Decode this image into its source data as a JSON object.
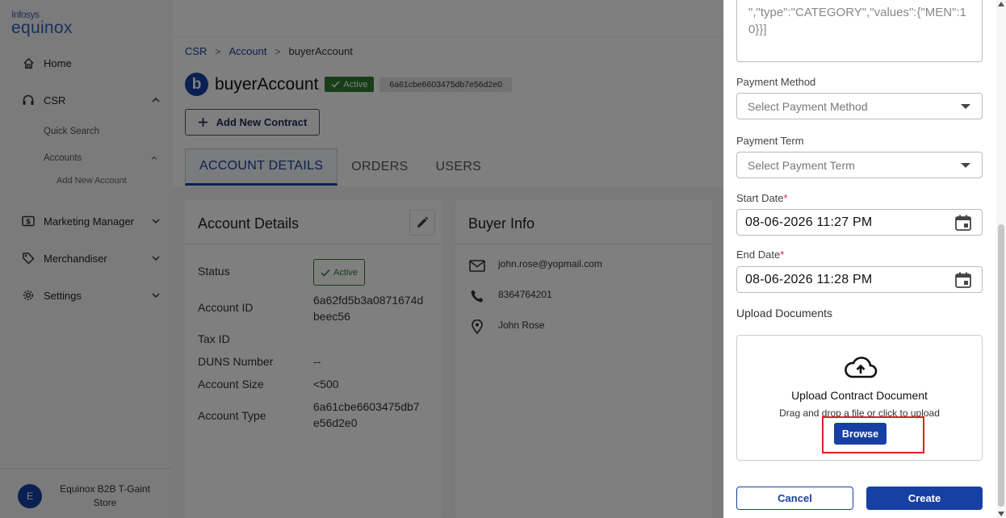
{
  "brand": {
    "line1": "Infosys",
    "line2": "equinox"
  },
  "sidebar": {
    "items": [
      {
        "label": "Home",
        "icon": "home-icon"
      },
      {
        "label": "CSR",
        "icon": "headset-icon"
      },
      {
        "label": "Marketing Manager",
        "icon": "dollar-icon"
      },
      {
        "label": "Merchandiser",
        "icon": "tag-icon"
      },
      {
        "label": "Settings",
        "icon": "gear-icon"
      }
    ],
    "csr_sub": {
      "quick_search": "Quick Search",
      "accounts": "Accounts",
      "add_new_account": "Add New Account"
    },
    "footer": {
      "avatar": "E",
      "store_name": "Equinox B2B T-Gaint Store"
    }
  },
  "breadcrumb": {
    "items": [
      "CSR",
      "Account",
      "buyerAccount"
    ],
    "separator": ">"
  },
  "account": {
    "initial": "b",
    "name": "buyerAccount",
    "status": "Active",
    "id_chip": "6a61cbe6603475db7e56d2e0"
  },
  "actions": {
    "add_contract": "Add New Contract"
  },
  "tabs": [
    "ACCOUNT DETAILS",
    "ORDERS",
    "USERS"
  ],
  "account_details": {
    "title": "Account Details",
    "rows": {
      "status_label": "Status",
      "status_value": "Active",
      "account_id_label": "Account ID",
      "account_id_value": "6a62fd5b3a0871674dbeec56",
      "tax_id_label": "Tax ID",
      "duns_label": "DUNS Number",
      "duns_value": "--",
      "size_label": "Account Size",
      "size_value": "<500",
      "type_label": "Account Type",
      "type_value": "6a61cbe6603475db7e56d2e0"
    }
  },
  "buyer_info": {
    "title": "Buyer Info",
    "email": "john.rose@yopmail.com",
    "phone": "8364764201",
    "name": "John Rose"
  },
  "drawer": {
    "textarea_text": "\",\"type\":\"CATEGORY\",\"values\":{\"MEN\":10}}]",
    "payment_method_label": "Payment Method",
    "payment_method_placeholder": "Select Payment Method",
    "payment_term_label": "Payment Term",
    "payment_term_placeholder": "Select Payment Term",
    "start_date_label": "Start Date",
    "start_date_value": "08-06-2026 11:27 PM",
    "end_date_label": "End Date",
    "end_date_value": "08-06-2026 11:28 PM",
    "required_mark": "*",
    "upload_label": "Upload Documents",
    "upload_title": "Upload Contract Document",
    "upload_hint": "Drag and drop a file or click to upload",
    "browse_label": "Browse",
    "cancel_label": "Cancel",
    "create_label": "Create"
  },
  "colors": {
    "primary": "#1740a4",
    "success": "#2e7d32",
    "highlight": "#e02020"
  }
}
